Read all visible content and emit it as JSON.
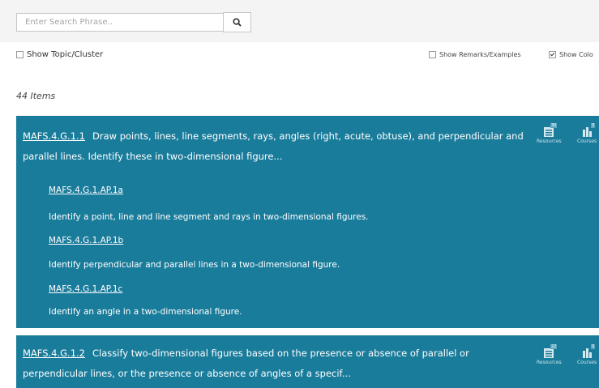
{
  "search": {
    "placeholder": "Enter Search Phrase.."
  },
  "options": {
    "show_topic_cluster": "Show Topic/Cluster",
    "show_remarks_examples": "Show Remarks/Examples",
    "show_color": "Show Colo"
  },
  "items_count": "44 Items",
  "standards": [
    {
      "code": "MAFS.4.G.1.1",
      "text": "Draw points, lines, line segments, rays, angles (right, acute, obtuse), and perpendicular and parallel lines. Identify these in two-dimensional figure...",
      "resources_label": "Resources",
      "resources_count": "30",
      "courses_label": "Courses",
      "courses_count": "3",
      "access_points": [
        {
          "code": "MAFS.4.G.1.AP.1a",
          "text": "Identify a point, line and line segment and rays in two-dimensional figures."
        },
        {
          "code": "MAFS.4.G.1.AP.1b",
          "text": "Identify perpendicular and parallel lines in a two-dimensional figure."
        },
        {
          "code": "MAFS.4.G.1.AP.1c",
          "text": "Identify an angle in a two-dimensional figure."
        }
      ]
    },
    {
      "code": "MAFS.4.G.1.2",
      "text": "Classify two-dimensional figures based on the presence or absence of parallel or perpendicular lines, or the presence or absence of angles of a specif...",
      "resources_label": "Resources",
      "resources_count": "22",
      "courses_label": "Courses",
      "courses_count": "3"
    }
  ]
}
